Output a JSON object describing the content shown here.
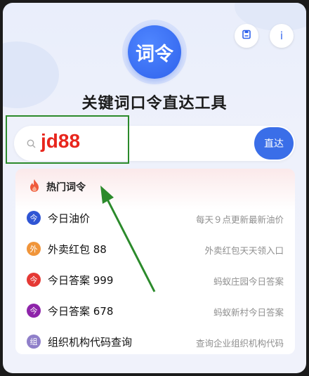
{
  "header": {
    "logo_text": "词令",
    "title": "关键词口令直达工具",
    "save_icon": "bookmark-icon",
    "info_label": "i"
  },
  "search": {
    "value": "jd88",
    "go_label": "直达"
  },
  "hot": {
    "title": "热门词令",
    "items": [
      {
        "badge": "今",
        "name": "今日油价",
        "desc": "每天９点更新最新油价",
        "color": "#2f55d4"
      },
      {
        "badge": "外",
        "name": "外卖红包 88",
        "desc": "外卖红包天天领入口",
        "color": "#f0953a"
      },
      {
        "badge": "今",
        "name": "今日答案 999",
        "desc": "蚂蚁庄园今日答案",
        "color": "#e53935"
      },
      {
        "badge": "今",
        "name": "今日答案 678",
        "desc": "蚂蚁新村今日答案",
        "color": "#8e24aa"
      },
      {
        "badge": "组",
        "name": "组织机构代码查询",
        "desc": "查询企业组织机构代码",
        "color": "#8f7fc9"
      }
    ]
  },
  "colors": {
    "accent": "#3a6ee8",
    "annotation": "#2b8a2b",
    "search_text": "#e8251c"
  }
}
